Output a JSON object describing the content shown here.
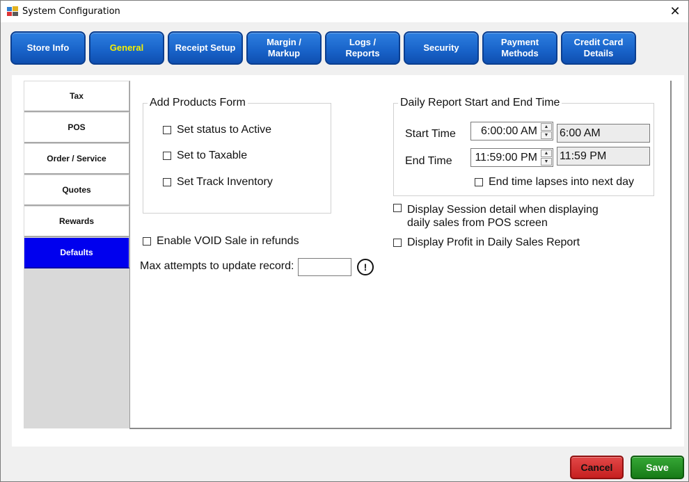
{
  "window": {
    "title": "System Configuration",
    "close_label": "✕"
  },
  "tabs": [
    {
      "label": "Store Info"
    },
    {
      "label": "General",
      "active": true
    },
    {
      "label": "Receipt Setup"
    },
    {
      "label": "Margin / Markup"
    },
    {
      "label": "Logs / Reports"
    },
    {
      "label": "Security"
    },
    {
      "label": "Payment Methods"
    },
    {
      "label": "Credit Card Details"
    }
  ],
  "sidebar": {
    "items": [
      {
        "label": "Tax"
      },
      {
        "label": "POS"
      },
      {
        "label": "Order / Service"
      },
      {
        "label": "Quotes"
      },
      {
        "label": "Rewards"
      },
      {
        "label": "Defaults",
        "active": true
      }
    ]
  },
  "add_products": {
    "legend": "Add Products Form",
    "options": [
      {
        "label": "Set status to Active",
        "checked": false
      },
      {
        "label": "Set to Taxable",
        "checked": false
      },
      {
        "label": "Set Track Inventory",
        "checked": false
      }
    ]
  },
  "enable_void": {
    "label": "Enable VOID Sale in refunds",
    "checked": false
  },
  "max_attempts": {
    "label": "Max attempts to update record:",
    "value": "",
    "info_icon": "!"
  },
  "daily_report": {
    "legend": "Daily Report Start and End Time",
    "start_label": "Start Time",
    "start_value": "6:00:00 AM",
    "start_display": "6:00 AM",
    "end_label": "End Time",
    "end_value": "11:59:00 PM",
    "end_display": "11:59 PM",
    "lapse_label": "End time lapses into next day",
    "lapse_checked": false,
    "spinner_up": "▲",
    "spinner_down": "▼"
  },
  "display_session": {
    "line1": "Display Session detail when displaying",
    "line2": "daily sales from POS screen",
    "checked": false
  },
  "display_profit": {
    "label": "Display Profit in Daily Sales Report",
    "checked": false
  },
  "footer": {
    "cancel_label": "Cancel",
    "save_label": "Save"
  },
  "colors": {
    "tab_blue": "#1862c8",
    "active_tab_text": "#f6f000",
    "sidebar_active": "#0000ee",
    "cancel_red": "#d42f2f",
    "save_green": "#1f8f1f"
  }
}
